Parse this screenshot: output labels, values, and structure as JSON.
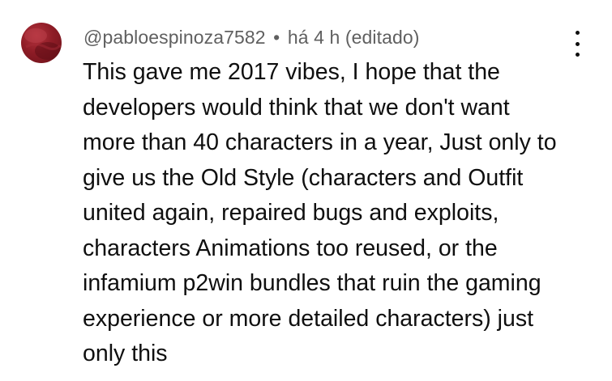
{
  "comment": {
    "author": "@pabloespinoza7582",
    "separator": "•",
    "time": "há 4 h",
    "edited": "(editado)",
    "text": "This gave me 2017 vibes, I hope that the\ndevelopers would think that we don't want\nmore than 40 characters in a year, Just only to\ngive us the Old Style (characters and Outfit\nunited again, repaired bugs and exploits,\ncharacters Animations too reused, or the\ninfamium p2win bundles that ruin the gaming\nexperience or more detailed characters) just\nonly this"
  },
  "icons": {
    "avatar": "avatar-icon",
    "menu": "more-vertical-icon"
  },
  "colors": {
    "meta_text": "#606060",
    "body_text": "#0f0f0f",
    "avatar": "#8e1c26"
  }
}
